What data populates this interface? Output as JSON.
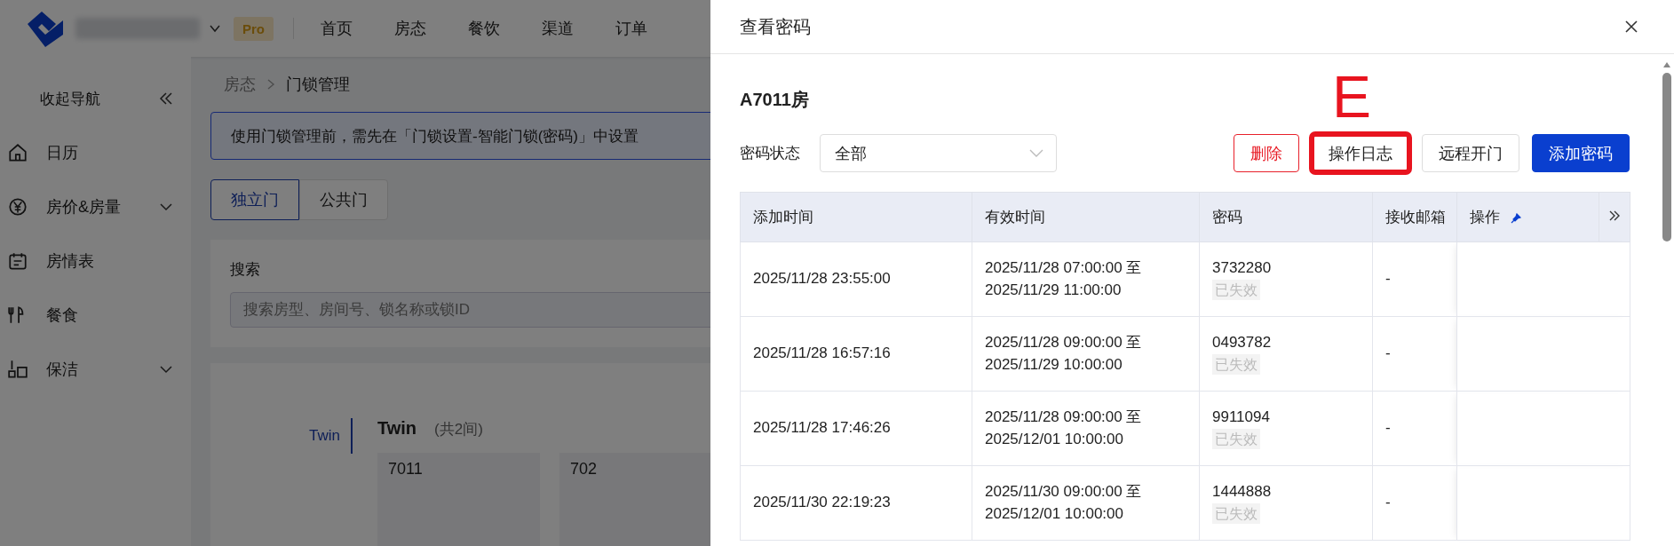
{
  "header": {
    "badge": "Pro",
    "nav": [
      {
        "label": "首页"
      },
      {
        "label": "房态"
      },
      {
        "label": "餐饮"
      },
      {
        "label": "渠道"
      },
      {
        "label": "订单"
      }
    ]
  },
  "sidebar": {
    "collapse": "收起导航",
    "items": [
      {
        "label": "日历",
        "has_submenu": false
      },
      {
        "label": "房价&房量",
        "has_submenu": true
      },
      {
        "label": "房情表",
        "has_submenu": false
      },
      {
        "label": "餐食",
        "has_submenu": false
      },
      {
        "label": "保洁",
        "has_submenu": true
      }
    ]
  },
  "breadcrumb": [
    "房态",
    "门锁管理"
  ],
  "alert": "使用门锁管理前，需先在「门锁设置-智能门锁(密码)」中设置",
  "tabs": [
    {
      "label": "独立门",
      "selected": true
    },
    {
      "label": "公共门",
      "selected": false
    }
  ],
  "search": {
    "label": "搜索",
    "placeholder": "搜索房型、房间号、锁名称或锁ID"
  },
  "room_types": [
    {
      "label": "Twin",
      "selected": true
    }
  ],
  "room_group": {
    "title": "Twin",
    "count": "(共2间)",
    "rooms": [
      "7011",
      "702"
    ]
  },
  "drawer": {
    "title": "查看密码",
    "room": "A7011房",
    "filter": {
      "label": "密码状态",
      "value": "全部"
    },
    "buttons": [
      {
        "label": "删除",
        "kind": "danger",
        "highlighted": false
      },
      {
        "label": "操作日志",
        "kind": "default",
        "highlighted": true
      },
      {
        "label": "远程开门",
        "kind": "default",
        "highlighted": false
      },
      {
        "label": "添加密码",
        "kind": "primary",
        "highlighted": false
      }
    ],
    "annotation": "E",
    "table": {
      "columns": [
        "添加时间",
        "有效时间",
        "密码",
        "接收邮箱",
        "操作"
      ],
      "rows": [
        {
          "added": "2025/11/28 23:55:00",
          "valid": [
            "2025/11/28 07:00:00 至",
            "2025/11/29 11:00:00"
          ],
          "code": "3732280",
          "status": "已失效",
          "email": "-"
        },
        {
          "added": "2025/11/28 16:57:16",
          "valid": [
            "2025/11/28 09:00:00 至",
            "2025/11/29 10:00:00"
          ],
          "code": "0493782",
          "status": "已失效",
          "email": "-"
        },
        {
          "added": "2025/11/28 17:46:26",
          "valid": [
            "2025/11/28 09:00:00 至",
            "2025/12/01 10:00:00"
          ],
          "code": "9911094",
          "status": "已失效",
          "email": "-"
        },
        {
          "added": "2025/11/30 22:19:23",
          "valid": [
            "2025/11/30 09:00:00 至",
            "2025/12/01 10:00:00"
          ],
          "code": "1444888",
          "status": "已失效",
          "email": "-"
        }
      ]
    }
  }
}
